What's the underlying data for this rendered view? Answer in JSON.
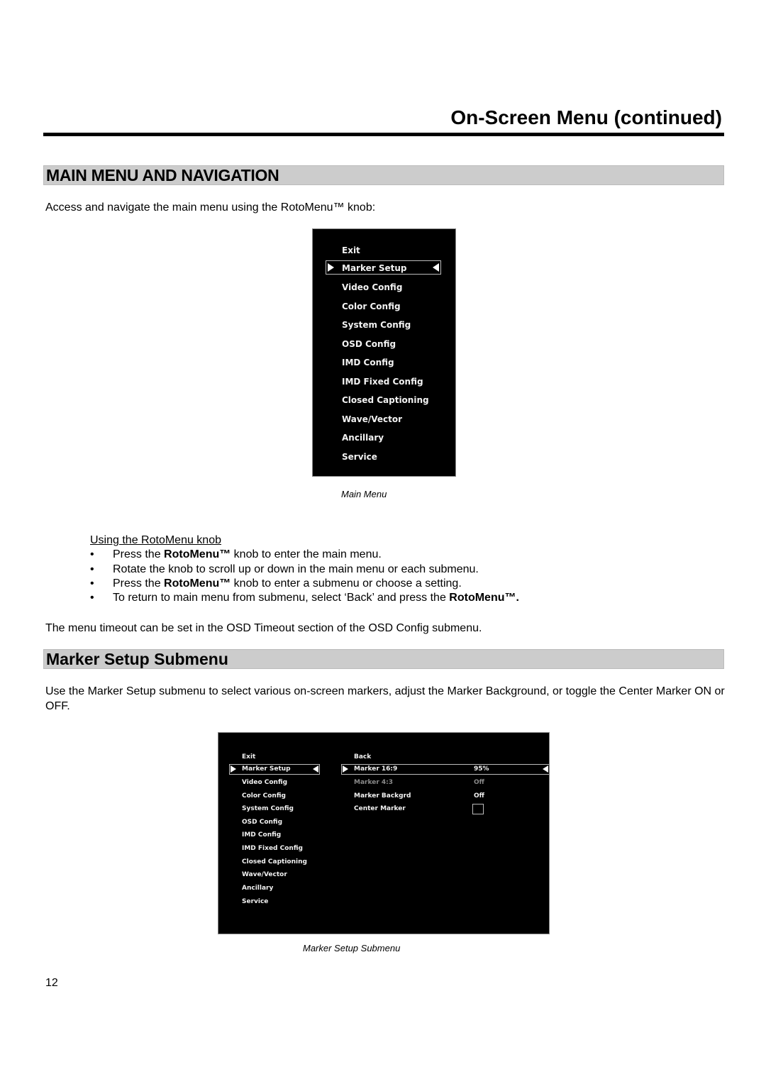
{
  "header": {
    "title": "On-Screen Menu (continued)"
  },
  "section1": {
    "heading": "MAIN MENU AND NAVIGATION",
    "intro": "Access and navigate the main menu using the RotoMenu™ knob:",
    "main_menu": {
      "items": [
        "Exit",
        "Marker Setup",
        "Video Config",
        "Color Config",
        "System Config",
        "OSD Config",
        "IMD Config",
        "IMD Fixed Config",
        "Closed Captioning",
        "Wave/Vector",
        "Ancillary",
        "Service"
      ],
      "selected": "Marker Setup",
      "caption": "Main Menu"
    },
    "usage": {
      "title": "Using the RotoMenu knob",
      "bullet_char": "•",
      "bullets": [
        {
          "pre": "Press the ",
          "bold": "RotoMenu™",
          "post": " knob to enter the main menu."
        },
        {
          "pre": "Rotate the knob to scroll up or down in the main menu or each submenu.",
          "bold": "",
          "post": ""
        },
        {
          "pre": "Press the ",
          "bold": "RotoMenu™",
          "post": " knob to enter a submenu or choose a setting."
        },
        {
          "pre": "To return to main menu from submenu, select ‘Back’ and press the ",
          "bold": "RotoMenu™.",
          "post": ""
        }
      ]
    },
    "timeout_note": "The menu timeout can be set in the OSD Timeout section of the OSD Config submenu."
  },
  "section2": {
    "heading": "Marker Setup Submenu",
    "intro": "Use the Marker Setup submenu to select various on-screen markers, adjust the Marker Background, or toggle the Center Marker ON or OFF.",
    "submenu": {
      "left_items": [
        "Exit",
        "Marker Setup",
        "Video Config",
        "Color Config",
        "System Config",
        "OSD Config",
        "IMD Config",
        "IMD Fixed Config",
        "Closed Captioning",
        "Wave/Vector",
        "Ancillary",
        "Service"
      ],
      "left_selected": "Marker Setup",
      "right_items": [
        {
          "label": "Back",
          "value": ""
        },
        {
          "label": "Marker 16:9",
          "value": "95%"
        },
        {
          "label": "Marker 4:3",
          "value": "Off"
        },
        {
          "label": "Marker Backgrd",
          "value": "Off"
        },
        {
          "label": "Center Marker",
          "value": "",
          "checkbox": false
        }
      ],
      "right_selected": "Marker 16:9",
      "caption": "Marker Setup Submenu"
    }
  },
  "footer": {
    "page_number": "12"
  }
}
